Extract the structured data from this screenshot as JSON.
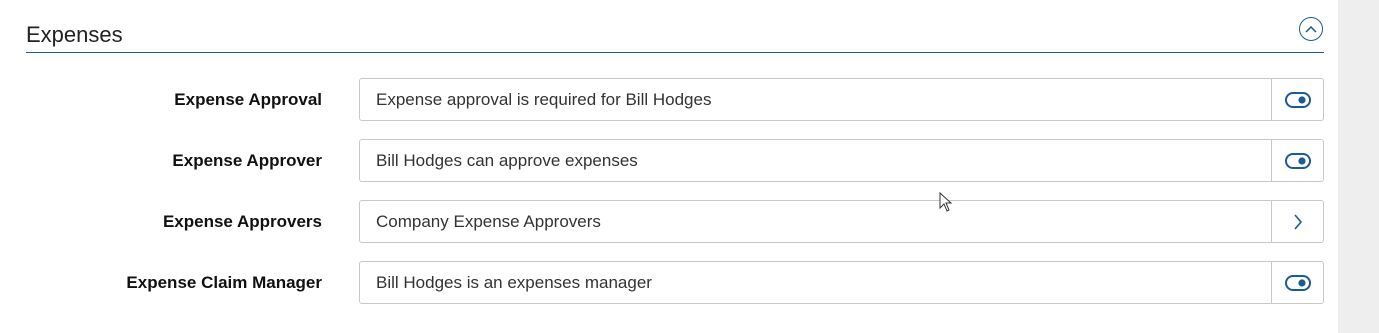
{
  "section": {
    "title": "Expenses"
  },
  "rows": [
    {
      "label": "Expense Approval",
      "value": "Expense approval is required for Bill Hodges",
      "action": "toggle-on"
    },
    {
      "label": "Expense Approver",
      "value": "Bill Hodges can approve expenses",
      "action": "toggle-on"
    },
    {
      "label": "Expense Approvers",
      "value": "Company Expense Approvers",
      "action": "chevron-right"
    },
    {
      "label": "Expense Claim Manager",
      "value": "Bill Hodges is an expenses manager",
      "action": "toggle-on"
    }
  ],
  "colors": {
    "accent": "#1a5a96",
    "border": "#c8c8c8",
    "scroll_strip": "#eeeeee"
  },
  "icons": {
    "collapse": "chevron-up-icon",
    "toggle": "toggle-on-icon",
    "navigate": "chevron-right-icon"
  }
}
